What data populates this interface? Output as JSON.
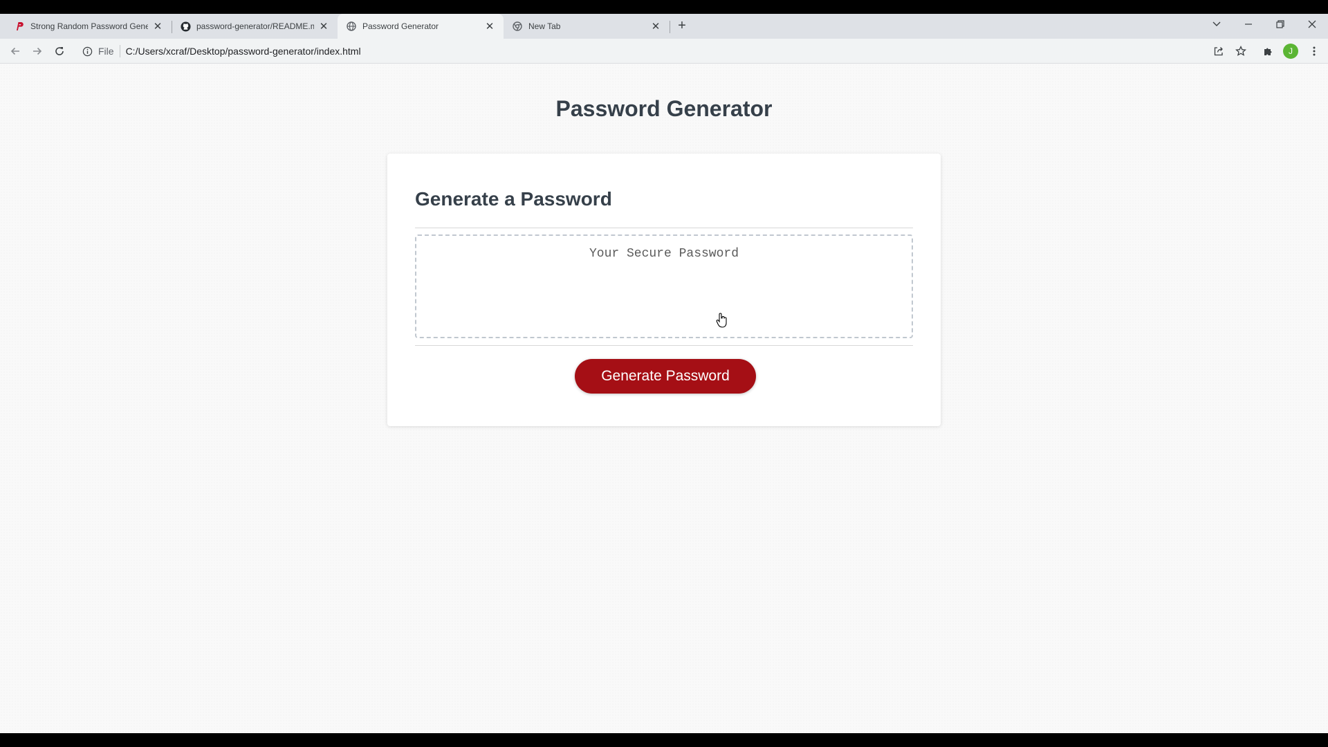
{
  "browser": {
    "tabs": [
      {
        "title": "Strong Random Password Gener",
        "favicon": "password-site-icon",
        "active": false
      },
      {
        "title": "password-generator/README.m",
        "favicon": "github-icon",
        "active": false
      },
      {
        "title": "Password Generator",
        "favicon": "globe-icon",
        "active": true
      },
      {
        "title": "New Tab",
        "favicon": "chrome-icon",
        "active": false
      }
    ],
    "new_tab_label": "+",
    "address": {
      "scheme_label": "File",
      "url": "C:/Users/xcraf/Desktop/password-generator/index.html"
    },
    "avatar_initial": "J",
    "colors": {
      "tab_strip": "#dee1e6",
      "toolbar": "#f1f3f4",
      "avatar": "#5bb534",
      "password_site_icon": "#c8102e"
    }
  },
  "page": {
    "title": "Password Generator",
    "card": {
      "heading": "Generate a Password",
      "password_placeholder": "Your Secure Password",
      "password_value": "",
      "generate_button_label": "Generate Password"
    },
    "colors": {
      "button": "#a50f15",
      "heading": "#36404a"
    }
  }
}
